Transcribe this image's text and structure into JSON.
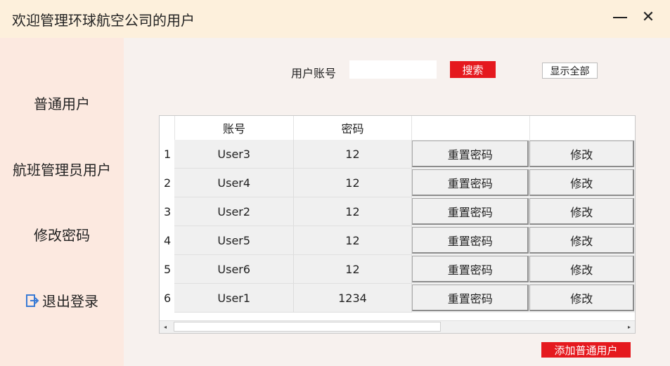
{
  "window": {
    "title": "欢迎管理环球航空公司的用户",
    "close_glyph": "✕"
  },
  "sidebar": {
    "items": [
      {
        "label": "普通用户"
      },
      {
        "label": "航班管理员用户"
      },
      {
        "label": "修改密码"
      },
      {
        "label": "退出登录",
        "icon": "logout-icon"
      }
    ]
  },
  "search": {
    "label": "用户账号",
    "value": "",
    "placeholder": "",
    "button_label": "搜索",
    "show_all_label": "显示全部"
  },
  "table": {
    "columns": [
      "账号",
      "密码",
      "",
      ""
    ],
    "rows": [
      {
        "num": "1",
        "account": "User3",
        "password": "12",
        "reset": "重置密码",
        "edit": "修改"
      },
      {
        "num": "2",
        "account": "User4",
        "password": "12",
        "reset": "重置密码",
        "edit": "修改"
      },
      {
        "num": "3",
        "account": "User2",
        "password": "12",
        "reset": "重置密码",
        "edit": "修改"
      },
      {
        "num": "4",
        "account": "User5",
        "password": "12",
        "reset": "重置密码",
        "edit": "修改"
      },
      {
        "num": "5",
        "account": "User6",
        "password": "12",
        "reset": "重置密码",
        "edit": "修改"
      },
      {
        "num": "6",
        "account": "User1",
        "password": "1234",
        "reset": "重置密码",
        "edit": "修改"
      }
    ]
  },
  "add_user_label": "添加普通用户",
  "colors": {
    "accent_red": "#e5191e",
    "titlebar_bg": "#fdf0dc",
    "sidebar_bg": "#fce9e0"
  }
}
